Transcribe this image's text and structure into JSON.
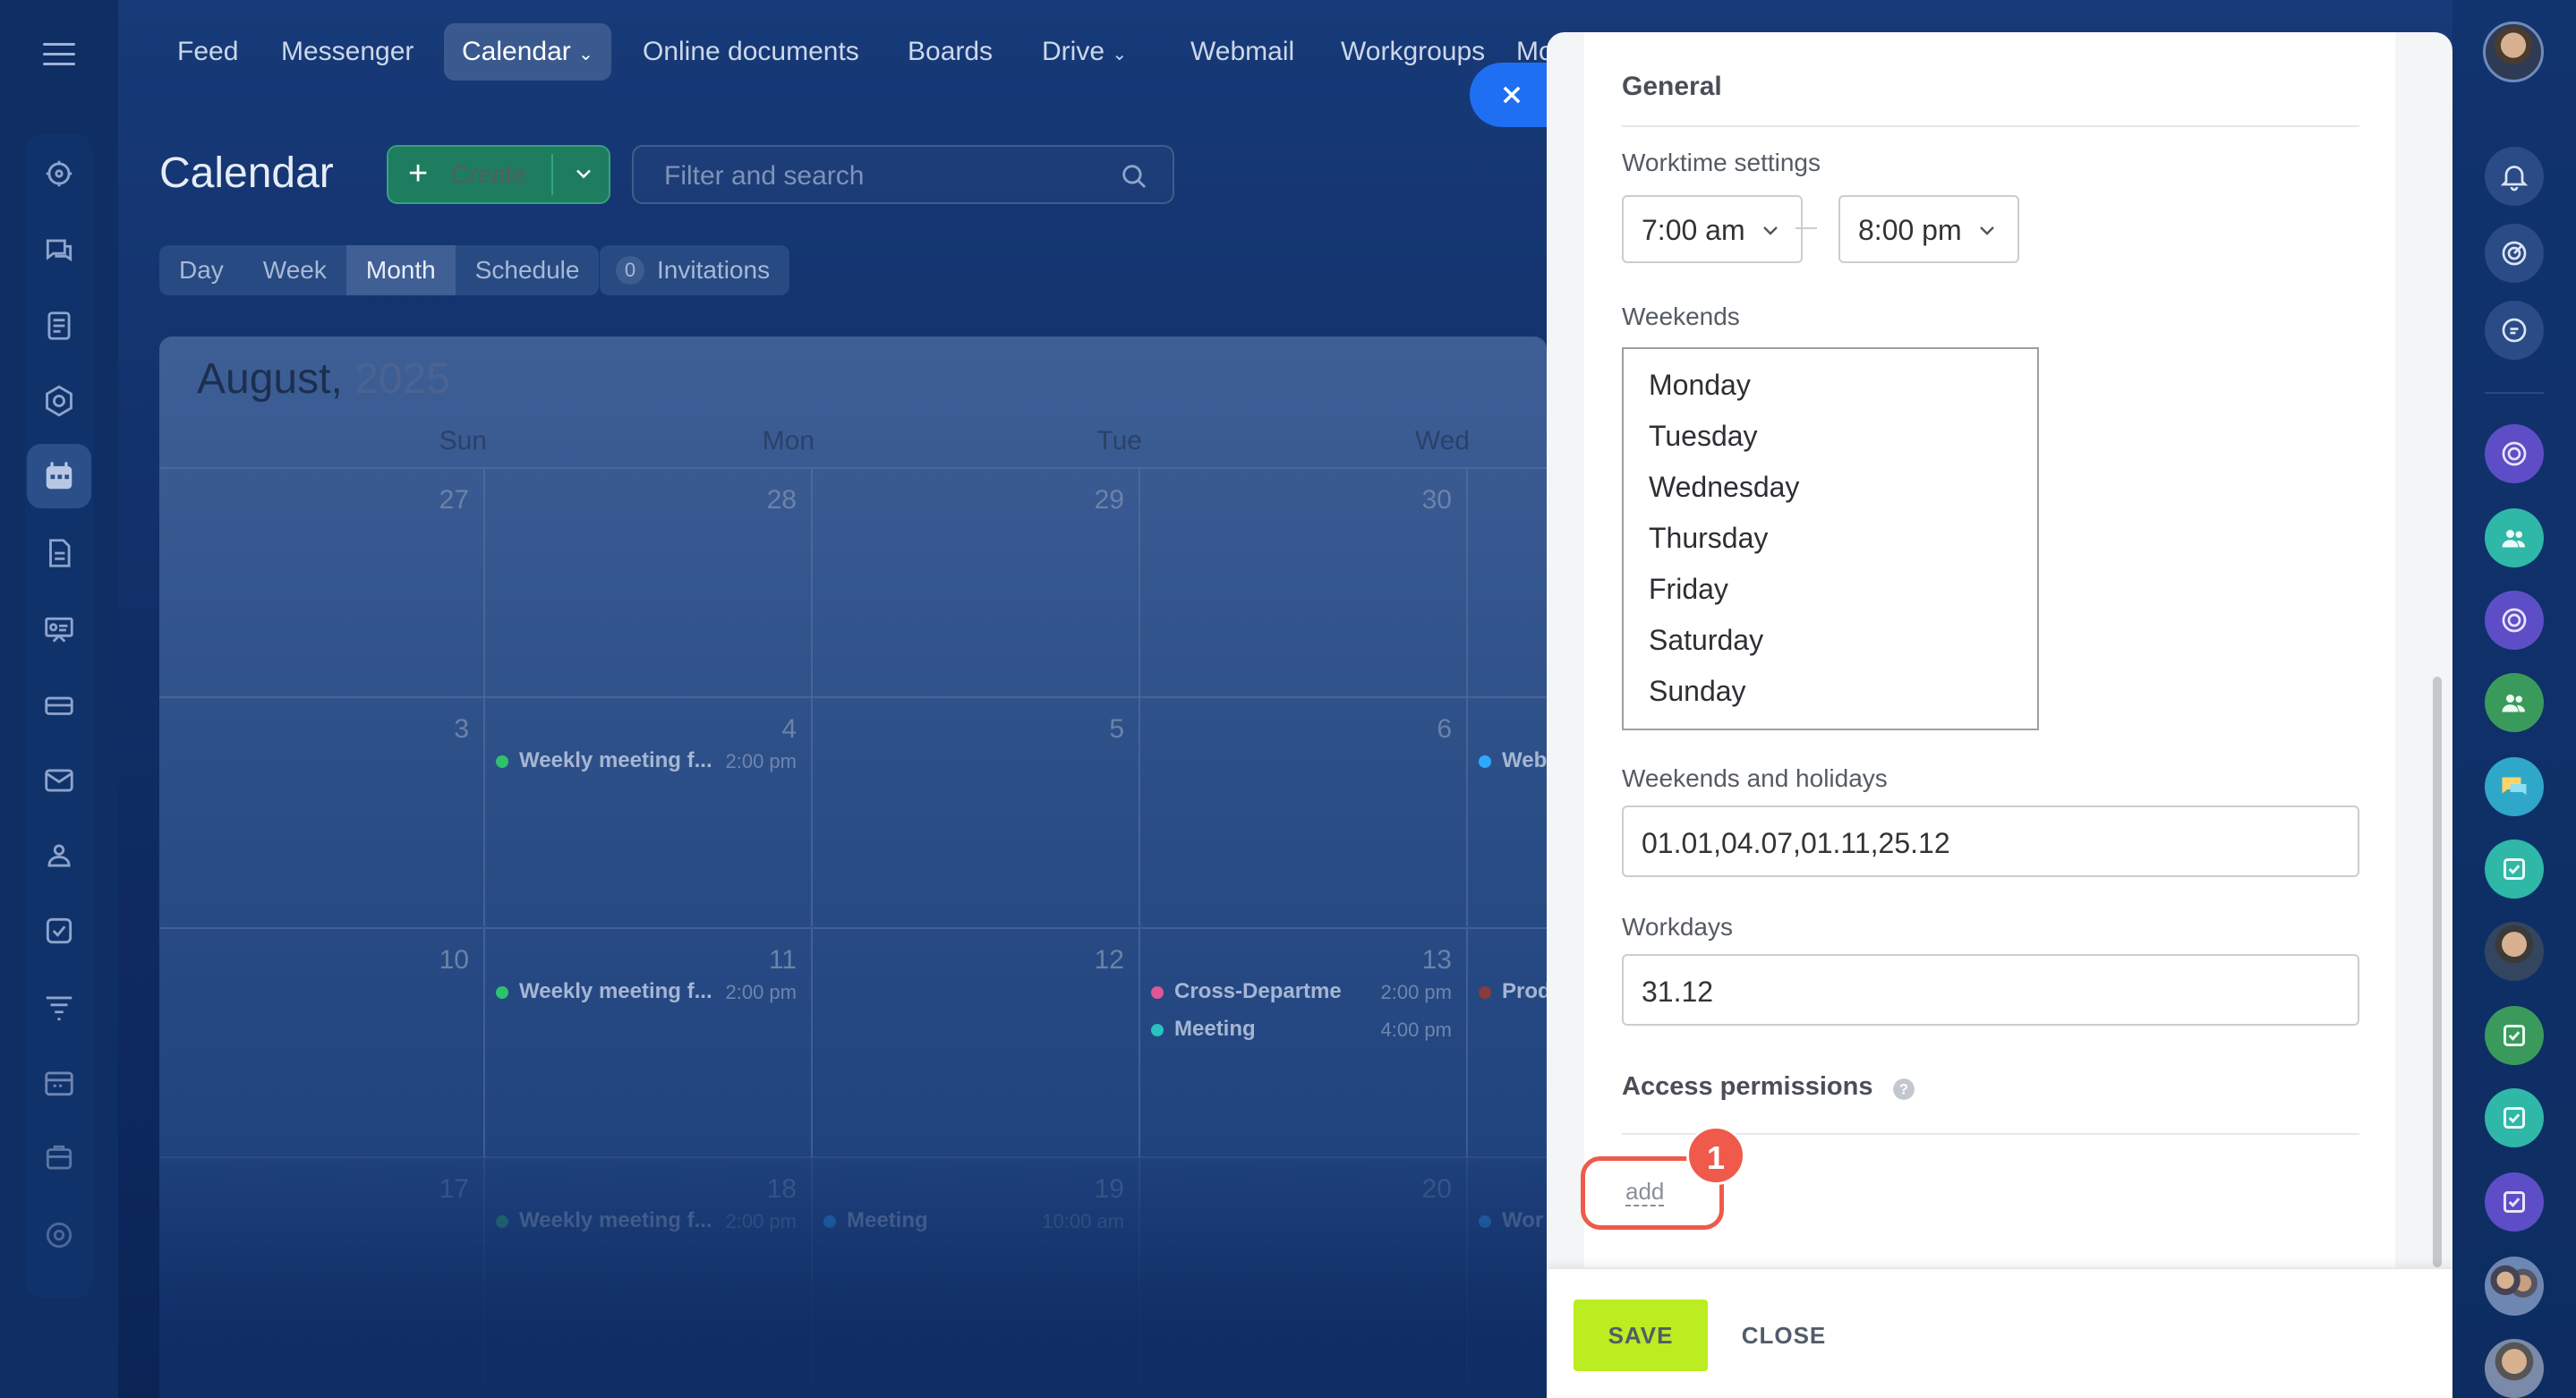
{
  "topnav": {
    "items": [
      "Feed",
      "Messenger",
      "Calendar",
      "Online documents",
      "Boards",
      "Drive",
      "Webmail",
      "Workgroups",
      "Mo"
    ],
    "active": "Calendar"
  },
  "calendar": {
    "title": "Calendar",
    "create_label": "Create",
    "search_placeholder": "Filter and search",
    "view_tabs": [
      "Day",
      "Week",
      "Month",
      "Schedule"
    ],
    "active_view": "Month",
    "invitations_count": "0",
    "invitations_label": "Invitations",
    "month_label": "August,",
    "year_label": "2025",
    "weekdays": [
      "Sun",
      "Mon",
      "Tue",
      "Wed"
    ],
    "weeks": [
      {
        "days": [
          {
            "num": "27",
            "events": []
          },
          {
            "num": "28",
            "events": []
          },
          {
            "num": "29",
            "events": []
          },
          {
            "num": "30",
            "events": []
          },
          {
            "num": "",
            "events": []
          }
        ]
      },
      {
        "days": [
          {
            "num": "3",
            "events": []
          },
          {
            "num": "4",
            "events": [
              {
                "name": "Weekly meeting f...",
                "time": "2:00 pm",
                "color": "#2fc26e"
              }
            ]
          },
          {
            "num": "5",
            "events": []
          },
          {
            "num": "6",
            "events": []
          },
          {
            "num": "",
            "events": [
              {
                "name": "Web",
                "time": "",
                "color": "#2fa9ff"
              }
            ]
          }
        ]
      },
      {
        "days": [
          {
            "num": "10",
            "events": []
          },
          {
            "num": "11",
            "events": [
              {
                "name": "Weekly meeting f...",
                "time": "2:00 pm",
                "color": "#2fc26e"
              }
            ]
          },
          {
            "num": "12",
            "events": []
          },
          {
            "num": "13",
            "events": [
              {
                "name": "Cross-Departme",
                "time": "2:00 pm",
                "color": "#e05597"
              },
              {
                "name": "Meeting",
                "time": "4:00 pm",
                "color": "#27c3bf"
              }
            ]
          },
          {
            "num": "",
            "events": [
              {
                "name": "Prod",
                "time": "",
                "color": "#8a3b3b"
              }
            ]
          }
        ]
      },
      {
        "days": [
          {
            "num": "17",
            "events": []
          },
          {
            "num": "18",
            "events": [
              {
                "name": "Weekly meeting f...",
                "time": "2:00 pm",
                "color": "#2fc26e"
              }
            ]
          },
          {
            "num": "19",
            "events": [
              {
                "name": "Meeting",
                "time": "10:00 am",
                "color": "#2fa9ff"
              }
            ]
          },
          {
            "num": "20",
            "events": []
          },
          {
            "num": "",
            "events": [
              {
                "name": "Wor",
                "time": "",
                "color": "#2fa9ff"
              }
            ]
          }
        ]
      }
    ]
  },
  "settings": {
    "section_general": "General",
    "worktime_label": "Worktime settings",
    "worktime_start": "7:00 am",
    "worktime_end": "8:00 pm",
    "weekends_label": "Weekends",
    "weekend_options": [
      "Monday",
      "Tuesday",
      "Wednesday",
      "Thursday",
      "Friday",
      "Saturday",
      "Sunday"
    ],
    "holidays_label": "Weekends and holidays",
    "holidays_value": "01.01,04.07,01.11,25.12",
    "workdays_label": "Workdays",
    "workdays_value": "31.12",
    "access_label": "Access permissions",
    "add_label": "add",
    "badge": "1",
    "save_label": "SAVE",
    "close_label": "CLOSE"
  }
}
